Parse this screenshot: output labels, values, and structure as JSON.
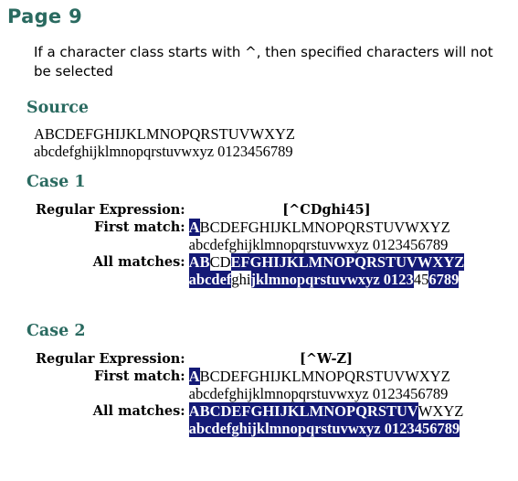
{
  "page_title": "Page 9",
  "intro_text": "If a character class starts with ^, then specified characters will not be selected",
  "source": {
    "heading": "Source",
    "line1": "ABCDEFGHIJKLMNOPQRSTUVWXYZ",
    "line2": "abcdefghijklmnopqrstuvwxyz 0123456789"
  },
  "regex_label": "Regular Expression:",
  "first_match_label": "First match:",
  "all_matches_label": "All matches:",
  "cases": [
    {
      "heading": "Case 1",
      "regex": "[^CDghi45]",
      "first_match": [
        [
          {
            "t": "A",
            "h": true
          },
          {
            "t": "BCDEFGHIJKLMNOPQRSTUVWXYZ",
            "h": false
          }
        ],
        [
          {
            "t": "abcdefghijklmnopqrstuvwxyz 0123456789",
            "h": false
          }
        ]
      ],
      "all_matches": [
        [
          {
            "t": "AB",
            "h": true
          },
          {
            "t": "CD",
            "h": false
          },
          {
            "t": "EFGHIJKLMNOPQRSTUVWXYZ",
            "h": true
          }
        ],
        [
          {
            "t": "abcdef",
            "h": true
          },
          {
            "t": "ghi",
            "h": false
          },
          {
            "t": "jklmnopqrstuvwxyz 0123",
            "h": true
          },
          {
            "t": "45",
            "h": false
          },
          {
            "t": "6789",
            "h": true
          }
        ]
      ]
    },
    {
      "heading": "Case 2",
      "regex": "[^W-Z]",
      "first_match": [
        [
          {
            "t": "A",
            "h": true
          },
          {
            "t": "BCDEFGHIJKLMNOPQRSTUVWXYZ",
            "h": false
          }
        ],
        [
          {
            "t": "abcdefghijklmnopqrstuvwxyz 0123456789",
            "h": false
          }
        ]
      ],
      "all_matches": [
        [
          {
            "t": "ABCDEFGHIJKLMNOPQRSTUV",
            "h": true
          },
          {
            "t": "WXYZ",
            "h": false
          }
        ],
        [
          {
            "t": "abcdefghijklmnopqrstuvwxyz 0123456789",
            "h": true
          }
        ]
      ]
    }
  ],
  "colors": {
    "heading": "#2a6a60",
    "highlight_bg": "#141a76",
    "highlight_fg": "#ffffff"
  }
}
